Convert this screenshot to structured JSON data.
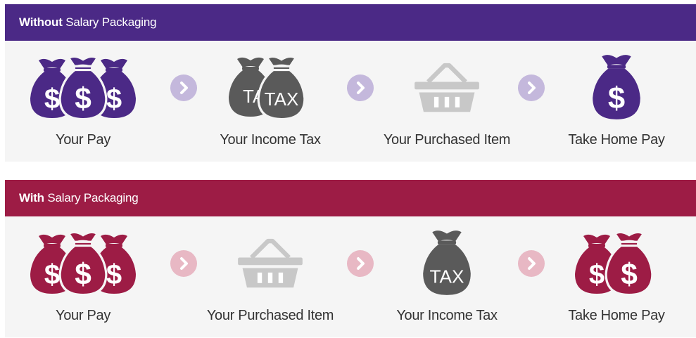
{
  "colors": {
    "purple": "#4b2986",
    "maroon": "#9d1c45",
    "gray": "#5a5a5a",
    "basket": "#c8c8c8",
    "purple_arrow": "#c4b8dc",
    "maroon_arrow": "#e8b8c4"
  },
  "without": {
    "header_bold": "Without",
    "header_rest": " Salary Packaging",
    "steps": [
      {
        "label": "Your Pay",
        "icon": "money-bags-icon"
      },
      {
        "label": "Your Income Tax",
        "icon": "tax-bags-icon"
      },
      {
        "label": "Your Purchased Item",
        "icon": "basket-icon"
      },
      {
        "label": "Take Home Pay",
        "icon": "money-bag-icon"
      }
    ],
    "tax_text_back": "TA",
    "tax_text_front": "TAX"
  },
  "with": {
    "header_bold": "With",
    "header_rest": " Salary Packaging",
    "steps": [
      {
        "label": "Your Pay",
        "icon": "money-bags-icon"
      },
      {
        "label": "Your Purchased Item",
        "icon": "basket-icon"
      },
      {
        "label": "Your Income Tax",
        "icon": "tax-bag-icon"
      },
      {
        "label": "Take Home Pay",
        "icon": "money-bags-two-icon"
      }
    ],
    "tax_text": "TAX"
  }
}
